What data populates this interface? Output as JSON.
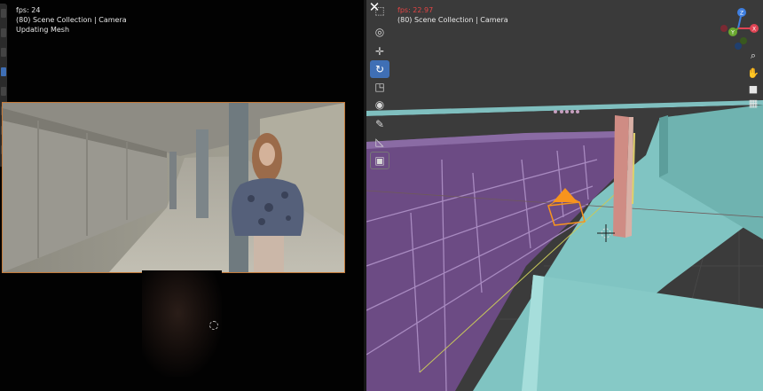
{
  "left_viewport": {
    "fps": "fps: 24",
    "collection": "(80) Scene Collection | Camera",
    "status": "Updating Mesh"
  },
  "right_viewport": {
    "fps": "fps: 22.97",
    "collection": "(80) Scene Collection | Camera"
  },
  "close_label": "✕",
  "toolbar": [
    {
      "icon": "select-box-icon",
      "glyph": "⬚"
    },
    {
      "icon": "cursor-icon",
      "glyph": "◎"
    },
    {
      "icon": "move-icon",
      "glyph": "✛"
    },
    {
      "icon": "rotate-icon",
      "glyph": "↻"
    },
    {
      "icon": "scale-icon",
      "glyph": "◳"
    },
    {
      "icon": "transform-icon",
      "glyph": "◉"
    },
    {
      "icon": "annotate-icon",
      "glyph": "✎"
    },
    {
      "icon": "measure-icon",
      "glyph": "◺"
    },
    {
      "icon": "add-cube-icon",
      "glyph": "▣"
    }
  ],
  "gizmo": {
    "x_label": "X",
    "y_label": "Y",
    "z_label": "Z",
    "x_color": "#e04454",
    "y_color": "#6aa830",
    "z_color": "#3f7fe0"
  },
  "nav_buttons": [
    {
      "icon": "zoom-icon",
      "glyph": "⌕"
    },
    {
      "icon": "hand-pan-icon",
      "glyph": "✋"
    },
    {
      "icon": "camera-view-icon",
      "glyph": "■"
    },
    {
      "icon": "grid-view-icon",
      "glyph": "▦"
    }
  ],
  "colors": {
    "fps_red": "#e34545",
    "active_blue": "#3f6fb5",
    "camera_outline": "#c47a3a",
    "platform": "#7fbfbf",
    "train": "#6c4b84"
  }
}
